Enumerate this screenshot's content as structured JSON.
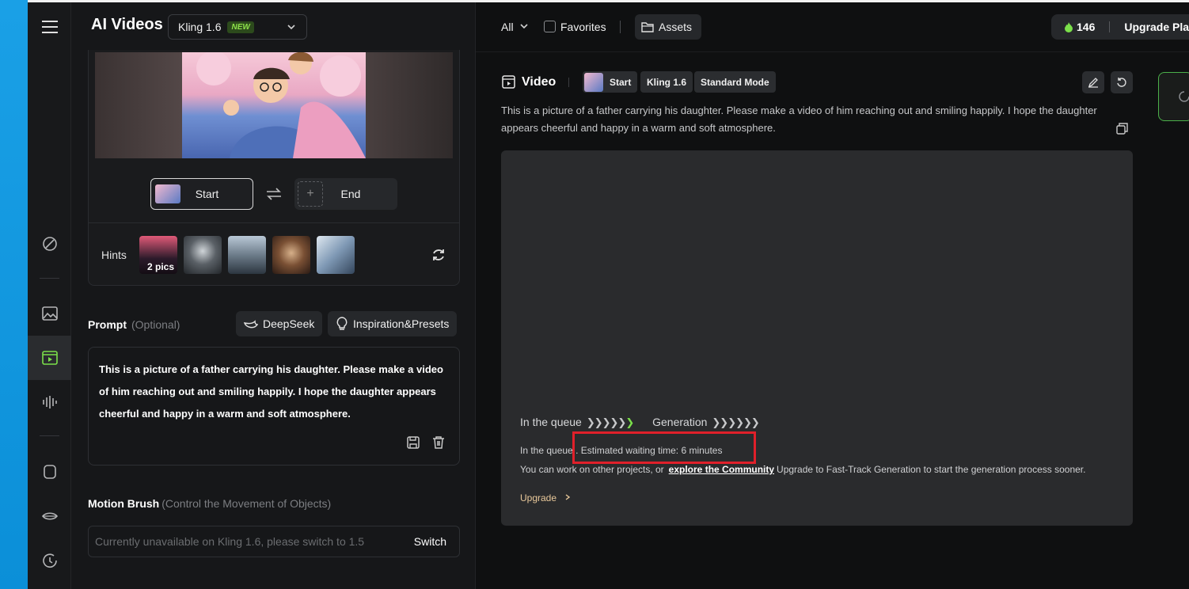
{
  "header": {
    "title": "AI Videos",
    "model": "Kling 1.6",
    "new_badge": "NEW",
    "filter_all": "All",
    "favorites": "Favorites",
    "assets": "Assets",
    "credits": "146",
    "upgrade_plan": "Upgrade Pla"
  },
  "frames": {
    "start": "Start",
    "end": "End"
  },
  "hints": {
    "label": "Hints",
    "count": "2 pics"
  },
  "prompt": {
    "label": "Prompt",
    "optional": "(Optional)",
    "deepseek": "DeepSeek",
    "presets": "Inspiration&Presets",
    "text": "This is a picture of a father carrying his daughter. Please make a video of him reaching out and smiling happily. I hope the daughter appears cheerful and happy in a warm and soft atmosphere."
  },
  "motion_brush": {
    "label": "Motion Brush",
    "sub": "(Control the Movement of Objects)",
    "placeholder": "Currently unavailable on Kling 1.6, please switch to 1.5",
    "switch": "Switch"
  },
  "video": {
    "title": "Video",
    "tag_start": "Start",
    "tag_model": "Kling 1.6",
    "tag_mode": "Standard Mode",
    "description": "This is a picture of a father carrying his daughter. Please make a video of him reaching out and smiling happily. I hope the daughter appears cheerful and happy in a warm and soft atmosphere.",
    "queue_label": "In the queue",
    "generation_label": "Generation",
    "queue_status_prefix": "In the queue",
    "queue_status": ".. Estimated waiting time: 6 minutes",
    "work_text": "You can work on other projects, or",
    "community_link": "explore the Community",
    "fast_track": "Upgrade to Fast-Track Generation to start the generation process sooner.",
    "upgrade": "Upgrade"
  },
  "colors": {
    "accent_green": "#7be04a",
    "highlight_red": "#e0202a"
  }
}
